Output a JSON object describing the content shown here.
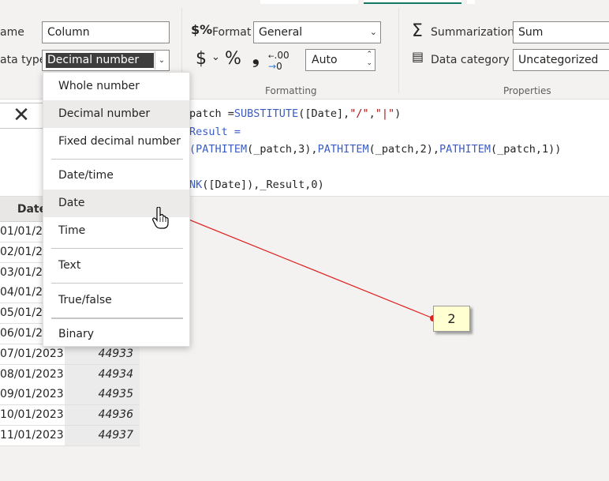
{
  "ribbon": {
    "name_label": "ame",
    "name_value": "Column",
    "data_type_label": "ata type",
    "data_type_value": "Decimal number",
    "format_label": "Format",
    "format_value": "General",
    "decimal_places": "Auto",
    "formatting_group": "Formatting",
    "summarization_label": "Summarization",
    "summarization_value": "Sum",
    "data_category_label": "Data category",
    "data_category_value": "Uncategorized",
    "properties_group": "Properties",
    "icons": {
      "format": "format-dollar-percent-icon",
      "currency": "$",
      "percent": "%",
      "comma": "❟",
      "decimal": ".00",
      "summarization": "Σ",
      "data_category": "data-category-icon"
    }
  },
  "formula": {
    "line1_a": "patch =",
    "line1_fn": "SUBSTITUTE",
    "line1_b": "([Date],",
    "line1_s1": "\"/\"",
    "line1_c": ",",
    "line1_s2": "\"|\"",
    "line1_d": ")",
    "line2": "Result =",
    "line3_fn1": "(PATHITEM",
    "line3_a": "(_patch,3),",
    "line3_fn2": "PATHITEM",
    "line3_b": "(_patch,2),",
    "line3_fn3": "PATHITEM",
    "line3_c": "(_patch,1))",
    "line5_fn": "NK",
    "line5_a": "([Date]),_Result,0)"
  },
  "table": {
    "header_date": "Date",
    "rows": [
      {
        "date": "01/01/2",
        "value": ""
      },
      {
        "date": "02/01/2",
        "value": ""
      },
      {
        "date": "03/01/2",
        "value": ""
      },
      {
        "date": "04/01/2",
        "value": ""
      },
      {
        "date": "05/01/2",
        "value": ""
      },
      {
        "date": "06/01/2",
        "value": ""
      },
      {
        "date": "07/01/2023",
        "value": "44933"
      },
      {
        "date": "08/01/2023",
        "value": "44934"
      },
      {
        "date": "09/01/2023",
        "value": "44935"
      },
      {
        "date": "10/01/2023",
        "value": "44936"
      },
      {
        "date": "11/01/2023",
        "value": "44937"
      }
    ]
  },
  "dropdown": {
    "items": [
      "Whole number",
      "Decimal number",
      "Fixed decimal number",
      "Date/time",
      "Date",
      "Time",
      "Text",
      "True/false",
      "Binary"
    ],
    "highlighted": [
      "Decimal number",
      "Date"
    ]
  },
  "annotation": {
    "callout_label": "2",
    "arrow_color": "#e02020"
  },
  "colors": {
    "dax_function": "#3b5cc4",
    "dax_string": "#a31515",
    "active_tab_underline": "#117865"
  }
}
